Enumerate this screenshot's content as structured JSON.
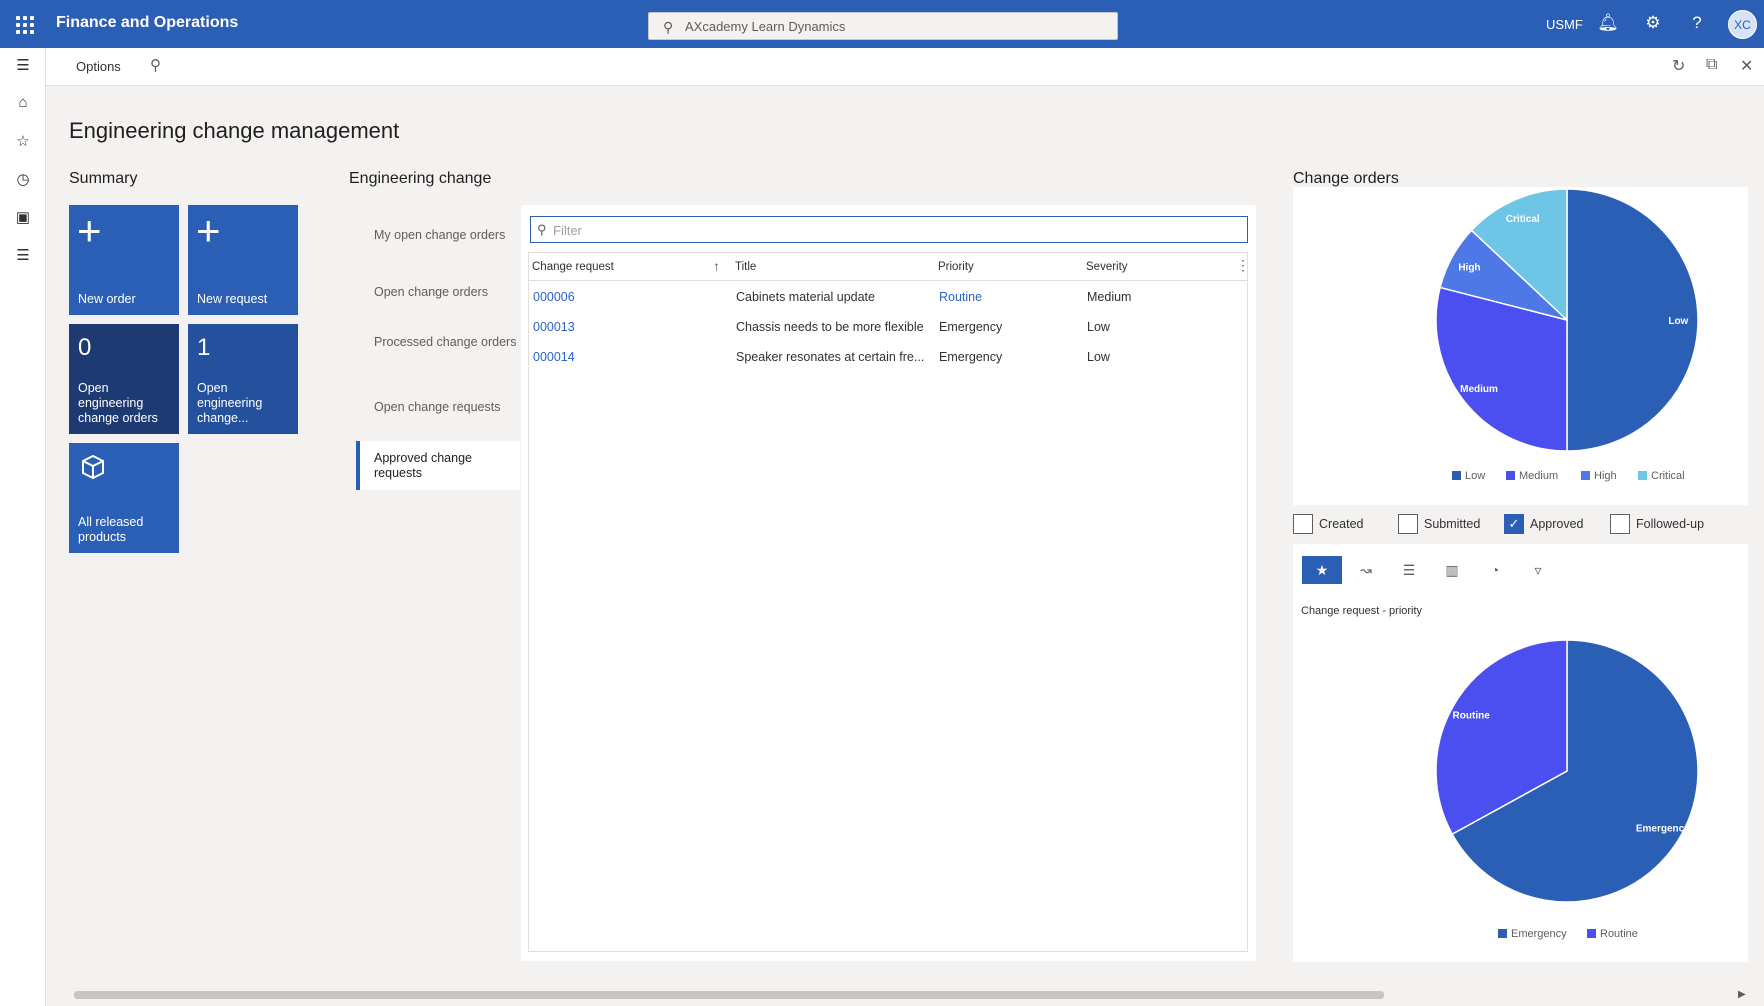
{
  "appbar": {
    "title": "Finance and Operations",
    "search_text": "AXcademy Learn Dynamics",
    "company": "USMF",
    "avatar": "XC",
    "icons": [
      "waffle-icon",
      "search-icon",
      "bell-icon",
      "gear-icon",
      "help-icon"
    ]
  },
  "actionpane": {
    "options_label": "Options"
  },
  "page": {
    "title": "Engineering change management"
  },
  "summary": {
    "title": "Summary",
    "tiles": [
      {
        "label": "New order"
      },
      {
        "label": "New request"
      },
      {
        "count": "0",
        "label": "Open engineering change orders"
      },
      {
        "count": "1",
        "label": "Open engineering change..."
      },
      {
        "label": "All released products"
      }
    ]
  },
  "engineering_change": {
    "title": "Engineering change",
    "tabs": [
      "My open change orders",
      "Open change orders",
      "Processed change orders",
      "Open change requests",
      "Approved change requests"
    ],
    "active_tab": "Approved change requests",
    "filter_placeholder": "Filter",
    "columns": [
      "Change request",
      "Title",
      "Priority",
      "Severity"
    ],
    "rows": [
      {
        "id": "000006",
        "title": "Cabinets material update",
        "priority": "Routine",
        "severity": "Medium"
      },
      {
        "id": "000013",
        "title": "Chassis needs to be more flexible",
        "priority": "Emergency",
        "severity": "Low"
      },
      {
        "id": "000014",
        "title": "Speaker resonates at certain fre...",
        "priority": "Emergency",
        "severity": "Low"
      }
    ]
  },
  "change_orders": {
    "title": "Change orders",
    "checkboxes": [
      {
        "label": "Created",
        "checked": false
      },
      {
        "label": "Submitted",
        "checked": false
      },
      {
        "label": "Approved",
        "checked": true
      },
      {
        "label": "Followed-up",
        "checked": false
      }
    ],
    "toolbar_icons": [
      "star-icon",
      "line-chart-icon",
      "bar-chart-icon",
      "column-chart-icon",
      "pie-chart-icon",
      "funnel-icon"
    ],
    "second_chart_title": "Change request - priority"
  },
  "chart_data": [
    {
      "type": "pie",
      "title": "",
      "slices": [
        {
          "label": "Low",
          "value": 50,
          "color": "#2b5fb6"
        },
        {
          "label": "Medium",
          "value": 29,
          "color": "#4b4ff0"
        },
        {
          "label": "High",
          "value": 8,
          "color": "#4d78e6"
        },
        {
          "label": "Critical",
          "value": 13,
          "color": "#6fc5e6"
        }
      ],
      "legend": "bottom",
      "legend_labels": [
        "Low",
        "Medium",
        "High",
        "Critical"
      ]
    },
    {
      "type": "pie",
      "title": "Change request - priority",
      "slices": [
        {
          "label": "Emergency",
          "value": 67,
          "color": "#2b5fb6"
        },
        {
          "label": "Routine",
          "value": 33,
          "color": "#4b4ff0"
        }
      ],
      "legend": "bottom",
      "legend_labels": [
        "Emergency",
        "Routine"
      ]
    }
  ]
}
